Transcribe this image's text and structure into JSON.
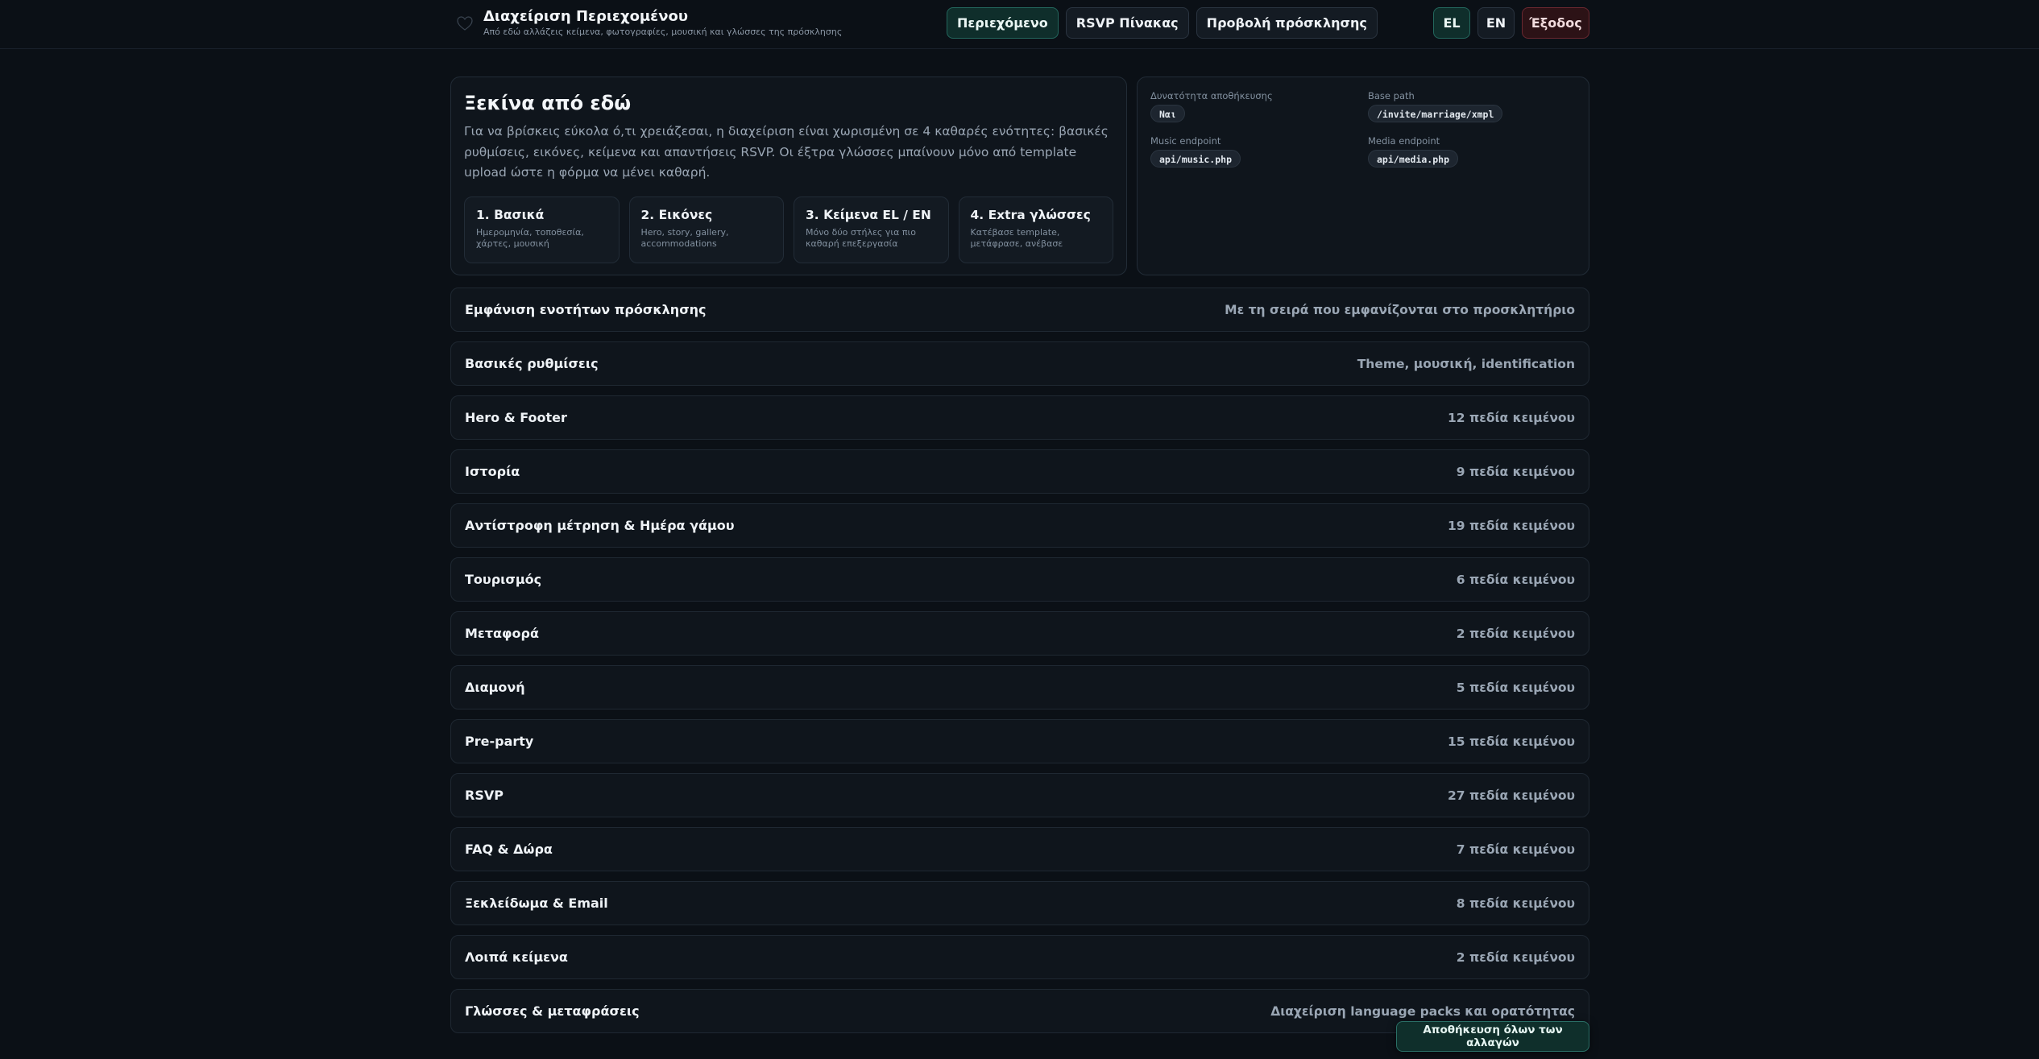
{
  "header": {
    "title": "Διαχείριση Περιεχομένου",
    "subtitle": "Από εδώ αλλάζεις κείμενα, φωτογραφίες, μουσική και γλώσσες της πρόσκλησης",
    "nav": [
      {
        "label": "Περιεχόμενο",
        "active": true
      },
      {
        "label": "RSVP Πίνακας",
        "active": false
      },
      {
        "label": "Προβολή πρόσκλησης",
        "active": false
      }
    ],
    "lang_el": "EL",
    "lang_en": "EN",
    "logout": "Έξοδος"
  },
  "intro": {
    "title": "Ξεκίνα από εδώ",
    "text": "Για να βρίσκεις εύκολα ό,τι χρειάζεσαι, η διαχείριση είναι χωρισμένη σε 4 καθαρές ενότητες: βασικές ρυθμίσεις, εικόνες, κείμενα και απαντήσεις RSVP. Οι έξτρα γλώσσες μπαίνουν μόνο από template upload ώστε η φόρμα να μένει καθαρή.",
    "steps": [
      {
        "title": "1. Βασικά",
        "desc": "Ημερομηνία, τοποθεσία, χάρτες, μουσική"
      },
      {
        "title": "2. Εικόνες",
        "desc": "Hero, story, gallery, accommodations"
      },
      {
        "title": "3. Κείμενα EL / EN",
        "desc": "Μόνο δύο στήλες για πιο καθαρή επεξεργασία"
      },
      {
        "title": "4. Extra γλώσσες",
        "desc": "Κατέβασε template, μετάφρασε, ανέβασε"
      }
    ]
  },
  "info": {
    "save_label": "Δυνατότητα αποθήκευσης",
    "save_value": "Ναι",
    "base_label": "Base path",
    "base_value": "/invite/marriage/xmpl",
    "music_label": "Music endpoint",
    "music_value": "api/music.php",
    "media_label": "Media endpoint",
    "media_value": "api/media.php"
  },
  "sections": [
    {
      "title": "Εμφάνιση ενοτήτων πρόσκλησης",
      "meta": "Με τη σειρά που εμφανίζονται στο προσκλητήριο"
    },
    {
      "title": "Βασικές ρυθμίσεις",
      "meta": "Theme, μουσική, identification"
    },
    {
      "title": "Hero & Footer",
      "meta": "12 πεδία κειμένου"
    },
    {
      "title": "Ιστορία",
      "meta": "9 πεδία κειμένου"
    },
    {
      "title": "Αντίστροφη μέτρηση & Ημέρα γάμου",
      "meta": "19 πεδία κειμένου"
    },
    {
      "title": "Τουρισμός",
      "meta": "6 πεδία κειμένου"
    },
    {
      "title": "Μεταφορά",
      "meta": "2 πεδία κειμένου"
    },
    {
      "title": "Διαμονή",
      "meta": "5 πεδία κειμένου"
    },
    {
      "title": "Pre-party",
      "meta": "15 πεδία κειμένου"
    },
    {
      "title": "RSVP",
      "meta": "27 πεδία κειμένου"
    },
    {
      "title": "FAQ & Δώρα",
      "meta": "7 πεδία κειμένου"
    },
    {
      "title": "Ξεκλείδωμα & Email",
      "meta": "8 πεδία κειμένου"
    },
    {
      "title": "Λοιπά κείμενα",
      "meta": "2 πεδία κειμένου"
    },
    {
      "title": "Γλώσσες & μεταφράσεις",
      "meta": "Διαχείριση language packs και ορατότητας"
    }
  ],
  "save_all": "Αποθήκευση όλων των αλλαγών",
  "colors": {
    "background": "#0b1016",
    "accent": "#23675d",
    "danger": "#6a2830"
  },
  "icons": {
    "brand": "heart-icon"
  }
}
